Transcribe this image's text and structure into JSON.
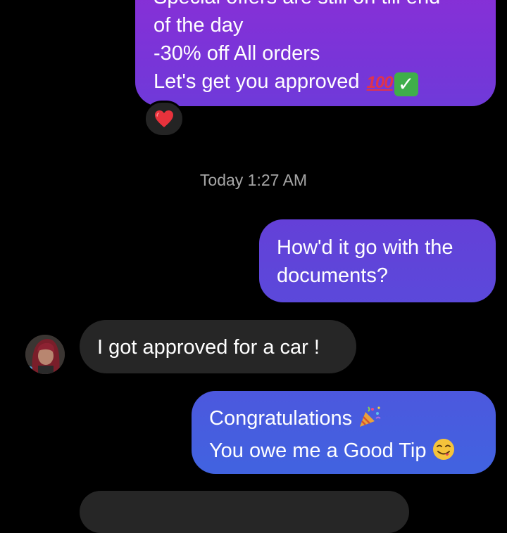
{
  "messages": {
    "offers": {
      "lines": [
        "Special offers are still on till end",
        "of the day",
        "-30% off All orders",
        "Let's get you approved"
      ],
      "emoji_1": "100-emoji",
      "emoji_2": "check-mark-emoji",
      "hundred": "100"
    },
    "reaction": "heart-emoji",
    "timestamp": "Today 1:27 AM",
    "documents": {
      "lines": [
        "How'd it go with the",
        "documents?"
      ]
    },
    "approved": {
      "text": "I got approved for a car !"
    },
    "congrats": {
      "lines": [
        "Congratulations",
        "You owe me a Good Tip"
      ],
      "emoji_1": "party-popper-emoji",
      "emoji_2": "yum-face-emoji"
    }
  },
  "colors": {
    "background": "#000000",
    "outgoing_top": "#8a2fd6",
    "outgoing_mid": "#5b49da",
    "outgoing_bottom": "#4163e0",
    "incoming": "#262626",
    "timestamp": "#a6a6a6"
  }
}
